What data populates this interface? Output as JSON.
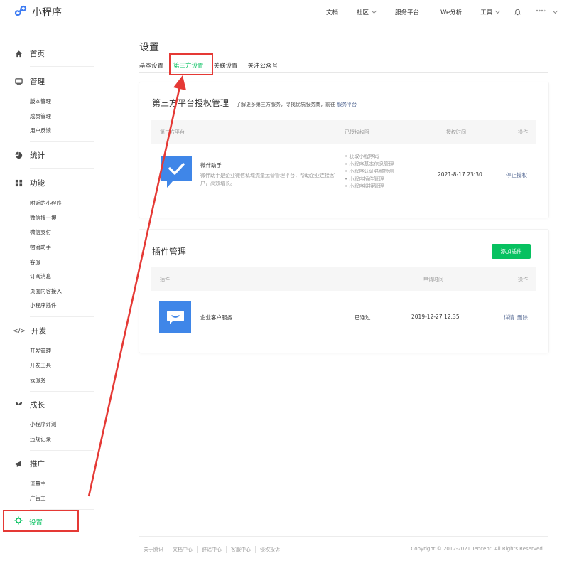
{
  "app": {
    "title": "小程序"
  },
  "topnav": {
    "docs": "文档",
    "community": "社区",
    "service_platform": "服务平台",
    "we_analytics": "We分析",
    "tools": "工具"
  },
  "sidebar": {
    "home": "首页",
    "manage": {
      "label": "管理",
      "items": [
        "版本管理",
        "成员管理",
        "用户反馈"
      ]
    },
    "stats": "统计",
    "features": {
      "label": "功能",
      "items": [
        "附近的小程序",
        "微信搜一搜",
        "微信支付",
        "物流助手",
        "客服",
        "订阅消息",
        "页面内容接入",
        "小程序插件"
      ]
    },
    "dev": {
      "label": "开发",
      "items": [
        "开发管理",
        "开发工具",
        "云服务"
      ]
    },
    "growth": {
      "label": "成长",
      "items": [
        "小程序评测",
        "违规记录"
      ]
    },
    "promo": {
      "label": "推广",
      "items": [
        "流量主",
        "广告主"
      ]
    },
    "settings": "设置"
  },
  "page": {
    "title": "设置",
    "tabs": [
      "基本设置",
      "第三方设置",
      "关联设置",
      "关注公众号"
    ],
    "active_tab": 1
  },
  "third_party": {
    "title": "第三方平台授权管理",
    "hint_prefix": "了解更多第三方服务，寻找优质服务商，前往",
    "hint_link": "服务平台",
    "columns": [
      "第三方平台",
      "已授权权限",
      "授权时间",
      "操作"
    ],
    "row": {
      "name": "微伴助手",
      "description": "微伴助手是企业微信私域流量运营管理平台，帮助企业连接客户，高效增长。",
      "permissions": [
        "获取小程序码",
        "小程序基本信息管理",
        "小程序认证名称检测",
        "小程序插件管理",
        "小程序链接管理"
      ],
      "time": "2021-8-17 23:30",
      "action": "停止授权"
    }
  },
  "plugins": {
    "title": "插件管理",
    "add_button": "添加插件",
    "columns": [
      "插件",
      "申请时间",
      "操作"
    ],
    "row": {
      "name": "企业客户服务",
      "status": "已通过",
      "time": "2019-12-27 12:35",
      "action_detail": "详情",
      "action_delete": "删除"
    }
  },
  "footer": {
    "links": [
      "关于腾讯",
      "文档中心",
      "辟谣中心",
      "客服中心",
      "侵权投诉"
    ],
    "copyright": "Copyright © 2012-2021 Tencent. All Rights Reserved."
  },
  "colors": {
    "accent": "#07c160",
    "link": "#576b95",
    "highlight": "#e53935",
    "app_icon": "#3f86e8"
  }
}
